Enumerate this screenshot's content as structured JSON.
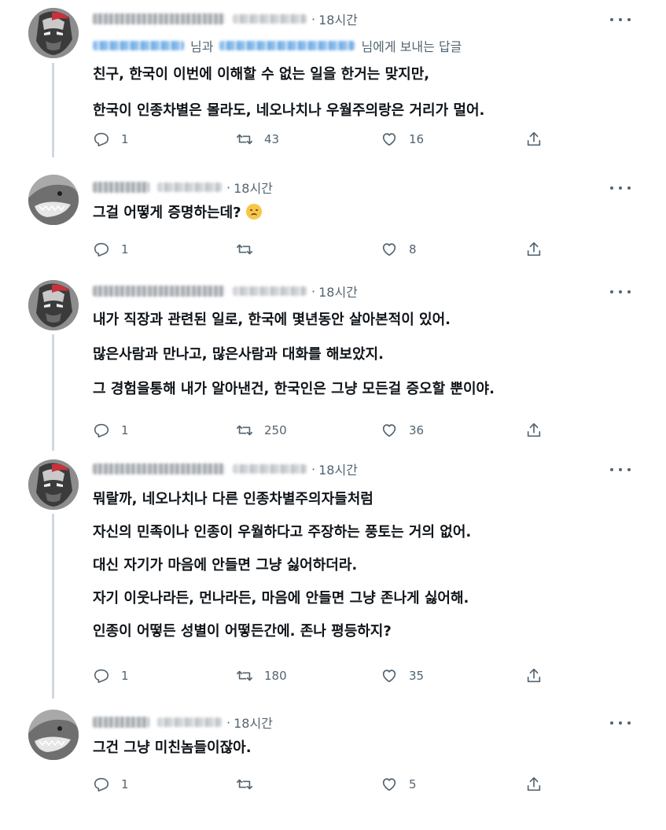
{
  "tweets": [
    {
      "time": "18시간",
      "reply_suffix": "님과",
      "reply_suffix2": "님에게 보내는 답글",
      "lines": [
        "친구, 한국이 이번에 이해할 수 없는 일을 한거는 맞지만,",
        "한국이 인종차별은 몰라도, 네오나치나 우월주의랑은 거리가 멀어."
      ],
      "replies": "1",
      "retweets": "43",
      "likes": "16"
    },
    {
      "time": "18시간",
      "lines": [
        "그걸 어떻게 증명하는데?"
      ],
      "replies": "1",
      "retweets": "",
      "likes": "8"
    },
    {
      "time": "18시간",
      "lines": [
        "내가 직장과 관련된 일로, 한국에 몇년동안 살아본적이 있어.",
        "많은사람과 만나고, 많은사람과 대화를 해보았지.",
        "그 경험을통해 내가 알아낸건, 한국인은 그냥 모든걸 증오할 뿐이야."
      ],
      "replies": "1",
      "retweets": "250",
      "likes": "36"
    },
    {
      "time": "18시간",
      "lines": [
        "뭐랄까, 네오나치나 다른 인종차별주의자들처럼",
        "자신의 민족이나 인종이 우월하다고 주장하는 풍토는 거의 없어.",
        "대신 자기가 마음에 안들면 그냥 싫어하더라.",
        "자기 이웃나라든, 먼나라든, 마음에 안들면 그냥 존나게 싫어해.",
        "인종이 어떻든 성별이 어떻든간에. 존나 평등하지?"
      ],
      "replies": "1",
      "retweets": "180",
      "likes": "35"
    },
    {
      "time": "18시간",
      "lines": [
        "그건 그냥 미친놈들이잖아."
      ],
      "replies": "1",
      "retweets": "",
      "likes": "5"
    }
  ]
}
